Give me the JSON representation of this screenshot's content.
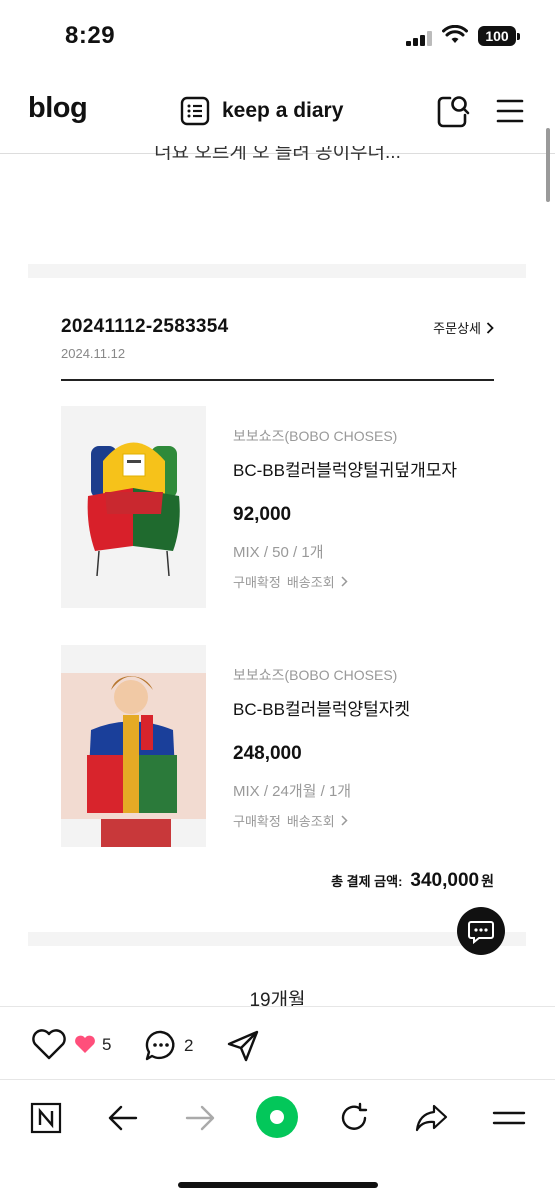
{
  "status_bar": {
    "time": "8:29",
    "battery": "100"
  },
  "header": {
    "logo": "blog",
    "title": "keep a diary",
    "icons": [
      "list-icon",
      "search-icon",
      "menu-icon"
    ]
  },
  "partial_text": "더요 오르게 오 들려 공이우더...",
  "order": {
    "number": "20241112-2583354",
    "date": "2024.11.12",
    "detail_label": "주문상세",
    "items": [
      {
        "brand": "보보쇼즈(BOBO CHOSES)",
        "name": "BC-BB컬러블럭양털귀덮개모자",
        "price": "92,000",
        "options": "MIX / 50 / 1개",
        "status": "구매확정",
        "tracking": "배송조회"
      },
      {
        "brand": "보보쇼즈(BOBO CHOSES)",
        "name": "BC-BB컬러블럭양털자켓",
        "price": "248,000",
        "options": "MIX / 24개월 / 1개",
        "status": "구매확정",
        "tracking": "배송조회"
      }
    ],
    "total_label": "총 결제 금액:",
    "total_value": "340,000",
    "total_unit": "원"
  },
  "section_text": "19개월",
  "reactions": {
    "likes": "5",
    "comments": "2"
  },
  "browser_nav": [
    "naver-icon",
    "back-icon",
    "forward-icon",
    "home-icon",
    "refresh-icon",
    "share-icon",
    "menu-icon"
  ],
  "colors": {
    "accent_green": "#03c75a",
    "heart_pink": "#ff4f7b"
  }
}
